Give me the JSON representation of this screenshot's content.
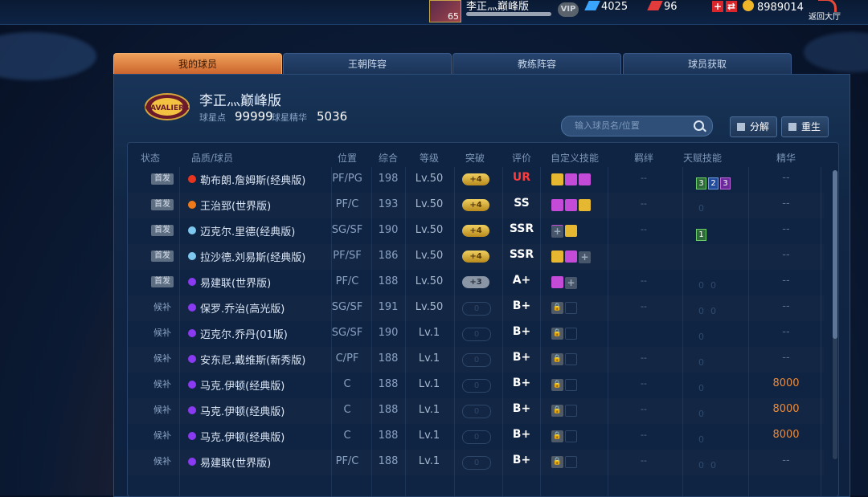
{
  "header": {
    "avatar_level": "65",
    "player_name": "李正灬巅峰版",
    "vip_label": "VIP",
    "gems": "4025",
    "tickets": "96",
    "gold": "8989014",
    "back_label": "返回大厅"
  },
  "tabs": [
    {
      "label": "我的球员",
      "active": true
    },
    {
      "label": "王朝阵容",
      "active": false
    },
    {
      "label": "教练阵容",
      "active": false
    },
    {
      "label": "球员获取",
      "active": false
    }
  ],
  "team": {
    "logo_text": "CAVALIERS",
    "name": "李正灬巅峰版",
    "star_points_label": "球星点",
    "star_points": "99999",
    "essence_label": "球星精华",
    "essence": "5036"
  },
  "search": {
    "placeholder": "输入球员名/位置"
  },
  "buttons": {
    "decompose": "分解",
    "rebirth": "重生"
  },
  "columns": [
    "状态",
    "品质/球员",
    "位置",
    "综合",
    "等级",
    "突破",
    "评价",
    "自定义技能",
    "羁绊",
    "天赋技能",
    "精华"
  ],
  "colors": {
    "accent_tab": "#e8904a",
    "red_quality": "#e8351f",
    "orange_quality": "#f07a1a",
    "blue_quality": "#7ec8f0",
    "purple_quality": "#8a3af0",
    "essence_orange": "#f08a35"
  },
  "rows": [
    {
      "status": "首发",
      "starter": true,
      "quality": "red",
      "name": "勒布朗.詹姆斯(经典版)",
      "pos": "PF/PG",
      "ovr": "198",
      "lv": "Lv.50",
      "brk": "+4",
      "brk_style": "gold",
      "grade": "UR",
      "skills": [
        "gold",
        "pink",
        "pink"
      ],
      "bond": "--",
      "talent": [
        [
          "g",
          "3"
        ],
        [
          "b",
          "2"
        ],
        [
          "p",
          "3"
        ]
      ],
      "essence": "--",
      "essence_orange": false
    },
    {
      "status": "首发",
      "starter": true,
      "quality": "orange",
      "name": "王治郅(世界版)",
      "pos": "PF/C",
      "ovr": "193",
      "lv": "Lv.50",
      "brk": "+4",
      "brk_style": "gold",
      "grade": "SS",
      "skills": [
        "pink",
        "pink",
        "gold"
      ],
      "bond": "--",
      "talent": [
        [
          "d",
          "0"
        ]
      ],
      "essence": "--",
      "essence_orange": false
    },
    {
      "status": "首发",
      "starter": true,
      "quality": "blue",
      "name": "迈克尔.里德(经典版)",
      "pos": "SG/SF",
      "ovr": "190",
      "lv": "Lv.50",
      "brk": "+4",
      "brk_style": "gold",
      "grade": "SSR",
      "skills": [
        "plus",
        "pink",
        "gold"
      ],
      "bond": "--",
      "talent": [
        [
          "g",
          "1"
        ]
      ],
      "essence": "--",
      "essence_orange": false
    },
    {
      "status": "首发",
      "starter": true,
      "quality": "blue",
      "name": "拉沙德.刘易斯(经典版)",
      "pos": "PF/SF",
      "ovr": "186",
      "lv": "Lv.50",
      "brk": "+4",
      "brk_style": "gold",
      "grade": "SSR",
      "skills": [
        "gold",
        "pink",
        "plus"
      ],
      "bond": "",
      "talent": [],
      "essence": "--",
      "essence_orange": false
    },
    {
      "status": "首发",
      "starter": true,
      "quality": "purple",
      "name": "易建联(世界版)",
      "pos": "PF/C",
      "ovr": "188",
      "lv": "Lv.50",
      "brk": "+3",
      "brk_style": "gray",
      "grade": "A+",
      "skills": [
        "pink",
        "plus"
      ],
      "bond": "--",
      "talent": [
        [
          "d",
          "0"
        ],
        [
          "d",
          "0"
        ]
      ],
      "essence": "--",
      "essence_orange": false
    },
    {
      "status": "候补",
      "starter": false,
      "quality": "purple",
      "name": "保罗.乔治(高光版)",
      "pos": "SG/SF",
      "ovr": "191",
      "lv": "Lv.50",
      "brk": "0",
      "brk_style": "empty",
      "grade": "B+",
      "skills": [
        "lock",
        "empty"
      ],
      "bond": "--",
      "talent": [
        [
          "d",
          "0"
        ],
        [
          "d",
          "0"
        ]
      ],
      "essence": "--",
      "essence_orange": false
    },
    {
      "status": "候补",
      "starter": false,
      "quality": "purple",
      "name": "迈克尔.乔丹(01版)",
      "pos": "SG/SF",
      "ovr": "190",
      "lv": "Lv.1",
      "brk": "0",
      "brk_style": "empty",
      "grade": "B+",
      "skills": [
        "lock",
        "empty"
      ],
      "bond": "",
      "talent": [
        [
          "d",
          "0"
        ]
      ],
      "essence": "--",
      "essence_orange": false
    },
    {
      "status": "候补",
      "starter": false,
      "quality": "purple",
      "name": "安东尼.戴维斯(新秀版)",
      "pos": "C/PF",
      "ovr": "188",
      "lv": "Lv.1",
      "brk": "0",
      "brk_style": "empty",
      "grade": "B+",
      "skills": [
        "lock",
        "empty"
      ],
      "bond": "--",
      "talent": [
        [
          "d",
          "0"
        ]
      ],
      "essence": "--",
      "essence_orange": false
    },
    {
      "status": "候补",
      "starter": false,
      "quality": "purple",
      "name": "马克.伊顿(经典版)",
      "pos": "C",
      "ovr": "188",
      "lv": "Lv.1",
      "brk": "0",
      "brk_style": "empty",
      "grade": "B+",
      "skills": [
        "lock",
        "empty"
      ],
      "bond": "--",
      "talent": [
        [
          "d",
          "0"
        ]
      ],
      "essence": "8000",
      "essence_orange": true
    },
    {
      "status": "候补",
      "starter": false,
      "quality": "purple",
      "name": "马克.伊顿(经典版)",
      "pos": "C",
      "ovr": "188",
      "lv": "Lv.1",
      "brk": "0",
      "brk_style": "empty",
      "grade": "B+",
      "skills": [
        "lock",
        "empty"
      ],
      "bond": "--",
      "talent": [
        [
          "d",
          "0"
        ]
      ],
      "essence": "8000",
      "essence_orange": true
    },
    {
      "status": "候补",
      "starter": false,
      "quality": "purple",
      "name": "马克.伊顿(经典版)",
      "pos": "C",
      "ovr": "188",
      "lv": "Lv.1",
      "brk": "0",
      "brk_style": "empty",
      "grade": "B+",
      "skills": [
        "lock",
        "empty"
      ],
      "bond": "--",
      "talent": [
        [
          "d",
          "0"
        ]
      ],
      "essence": "8000",
      "essence_orange": true
    },
    {
      "status": "候补",
      "starter": false,
      "quality": "purple",
      "name": "易建联(世界版)",
      "pos": "PF/C",
      "ovr": "188",
      "lv": "Lv.1",
      "brk": "0",
      "brk_style": "empty",
      "grade": "B+",
      "skills": [
        "lock",
        "empty"
      ],
      "bond": "--",
      "talent": [
        [
          "d",
          "0"
        ],
        [
          "d",
          "0"
        ]
      ],
      "essence": "--",
      "essence_orange": false
    }
  ]
}
